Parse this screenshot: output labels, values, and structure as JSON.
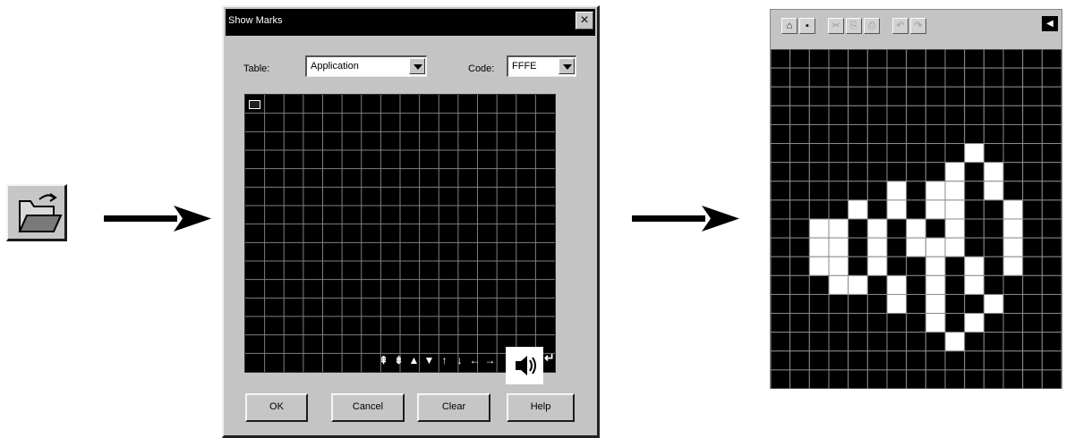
{
  "open_icon": {
    "name": "open-folder-icon"
  },
  "dialog": {
    "title": "Show Marks",
    "close_glyph": "×",
    "table_label": "Table:",
    "table_value": "Application",
    "code_label": "Code:",
    "code_value": "FFFE",
    "grid": {
      "cols": 16,
      "rows": 15
    },
    "toolbar_glyphs": [
      "⇞",
      "⇟",
      "▲",
      "▼",
      "↑",
      "↓",
      "←",
      "→"
    ],
    "enter_glyph": "↵",
    "buttons": {
      "ok": "OK",
      "cancel": "Cancel",
      "clear": "Clear",
      "help": "Help"
    }
  },
  "panel": {
    "toolbar_glyphs": [
      "⌂",
      "▪",
      "✂",
      "⎘",
      "⎙",
      "↶",
      "↷"
    ],
    "sound_glyph": "◀",
    "bitmap": {
      "cols": 15,
      "rows": 18,
      "white_cells": [
        [
          5,
          10
        ],
        [
          6,
          9
        ],
        [
          6,
          11
        ],
        [
          7,
          6
        ],
        [
          7,
          8
        ],
        [
          7,
          9
        ],
        [
          7,
          11
        ],
        [
          8,
          4
        ],
        [
          8,
          6
        ],
        [
          8,
          8
        ],
        [
          8,
          9
        ],
        [
          8,
          12
        ],
        [
          9,
          2
        ],
        [
          9,
          3
        ],
        [
          9,
          5
        ],
        [
          9,
          7
        ],
        [
          9,
          9
        ],
        [
          9,
          12
        ],
        [
          10,
          2
        ],
        [
          10,
          3
        ],
        [
          10,
          5
        ],
        [
          10,
          7
        ],
        [
          10,
          8
        ],
        [
          10,
          9
        ],
        [
          10,
          12
        ],
        [
          11,
          2
        ],
        [
          11,
          3
        ],
        [
          11,
          5
        ],
        [
          11,
          8
        ],
        [
          11,
          10
        ],
        [
          11,
          12
        ],
        [
          12,
          3
        ],
        [
          12,
          4
        ],
        [
          12,
          6
        ],
        [
          12,
          8
        ],
        [
          12,
          10
        ],
        [
          13,
          6
        ],
        [
          13,
          8
        ],
        [
          13,
          11
        ],
        [
          14,
          8
        ],
        [
          14,
          10
        ],
        [
          15,
          9
        ]
      ]
    }
  }
}
